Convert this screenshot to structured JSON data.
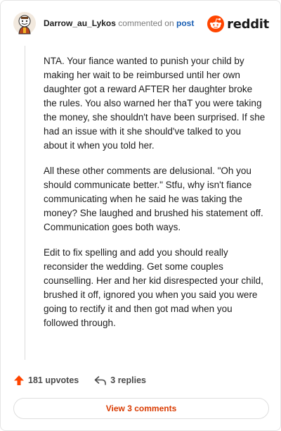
{
  "header": {
    "username": "Darrow_au_Lykos",
    "action_text": "commented on",
    "post_link": "post",
    "brand": "reddit"
  },
  "comment": {
    "paragraphs": [
      "NTA. Your fiance wanted to punish your child by making her wait to be reimbursed until her own daughter got a reward AFTER her daughter broke the rules. You also warned her thaT you were taking the money, she shouldn't have been surprised. If she had an issue with it she should've talked to you about it when you told her.",
      "All these other comments are delusional. \"Oh you should communicate better.\" Stfu, why isn't fiance communicating when he said he was taking the money? She laughed and brushed his statement off. Communication goes both ways.",
      "Edit to fix spelling and add you should really reconsider the wedding. Get some couples counselling. Her and her kid disrespected your child, brushed it off, ignored you when you said you were going to rectify it and then got mad when you followed through."
    ]
  },
  "actions": {
    "upvotes": "181 upvotes",
    "replies": "3 replies"
  },
  "footer": {
    "view_more": "View 3 comments"
  },
  "colors": {
    "brand_orange": "#ff4500",
    "link_blue": "#1a5fb4",
    "view_more_text": "#d93a00"
  }
}
